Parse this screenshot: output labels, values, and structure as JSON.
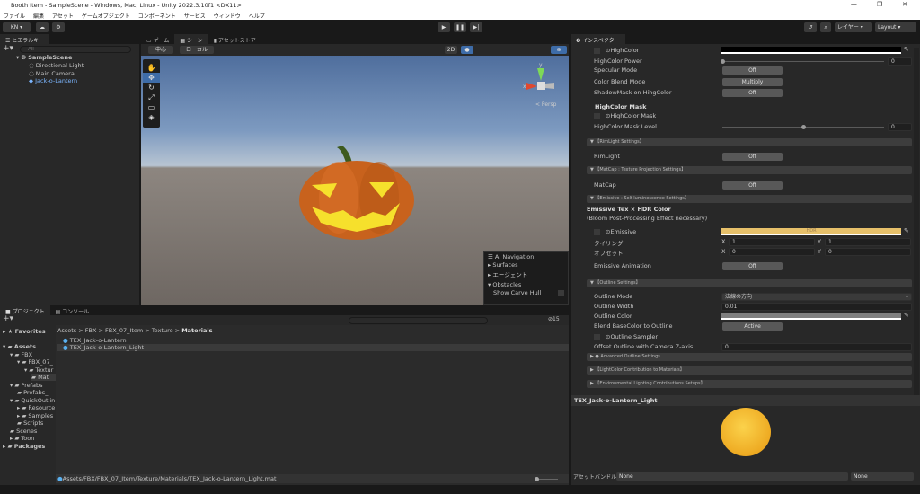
{
  "window": {
    "title": "Booth Item - SampleScene - Windows, Mac, Linux - Unity 2022.3.10f1 <DX11>",
    "controls": [
      "—",
      "❐",
      "✕"
    ]
  },
  "menu": [
    "ファイル",
    "編集",
    "アセット",
    "ゲームオブジェクト",
    "コンポーネント",
    "サービス",
    "ウィンドウ",
    "ヘルプ"
  ],
  "toolbar": {
    "account": "KN ▾",
    "layers": "レイヤー",
    "layout": "Layout"
  },
  "hierarchy": {
    "tab": "ヒエラルキー",
    "search_placeholder": "All",
    "scene": "SampleScene",
    "items": [
      "Directional Light",
      "Main Camera",
      "Jack-o-Lantern"
    ]
  },
  "scene_view": {
    "tabs": [
      "ゲーム",
      "シーン",
      "アセットストア"
    ],
    "pivot": "中心",
    "space": "ローカル",
    "mode_2d": "2D",
    "gizmo_label": "< Persp",
    "axis_x": "x",
    "axis_y": "y",
    "overlay": {
      "title": "AI Navigation",
      "items": [
        "Surfaces",
        "エージェント",
        "Obstacles"
      ],
      "option": "Show Carve Hull"
    }
  },
  "project": {
    "tabs": [
      "プロジェクト",
      "コンソール"
    ],
    "hidden_count": "15",
    "tree": [
      "Favorites",
      "Assets",
      "FBX",
      "FBX_07_",
      "Textur",
      "Mat",
      "Prefabs",
      "Prefabs_",
      "QuickOutlin",
      "Resource",
      "Samples",
      "Scripts",
      "Scenes",
      "Toon",
      "Packages"
    ],
    "breadcrumb": [
      "Assets",
      "FBX",
      "FBX_07_Item",
      "Texture",
      "Materials"
    ],
    "files": [
      "TEX_Jack-o-Lantern",
      "TEX_Jack-o-Lantern_Light"
    ],
    "status_path": "Assets/FBX/FBX_07_Item/Texture/Materials/TEX_Jack-o-Lantern_Light.mat"
  },
  "inspector": {
    "tab": "インスペクター",
    "rows": [
      {
        "t": "color",
        "label": "⊙HighColor",
        "color": "#000000"
      },
      {
        "t": "slider",
        "label": "HighColor Power",
        "value": "0",
        "pos": 0
      },
      {
        "t": "btn",
        "label": "Specular Mode",
        "value": "Off"
      },
      {
        "t": "btn",
        "label": "Color Blend Mode",
        "value": "Multiply"
      },
      {
        "t": "btn",
        "label": "ShadowMask on HihgColor",
        "value": "Off"
      },
      {
        "t": "bold",
        "label": "HighColor Mask"
      },
      {
        "t": "check",
        "label": "⊙HighColor Mask"
      },
      {
        "t": "slider",
        "label": "HighColor Mask Level",
        "value": "0",
        "pos": 0.5
      },
      {
        "t": "hdr",
        "label": "▼ 【RimLight Settings】"
      },
      {
        "t": "btn",
        "label": "RimLight",
        "value": "Off"
      },
      {
        "t": "hdr",
        "label": "▼ 【MatCap : Texture Projection Settings】"
      },
      {
        "t": "btn",
        "label": "MatCap",
        "value": "Off"
      },
      {
        "t": "hdr",
        "label": "▼ 【Emissive : Self-luminescence Settings】"
      },
      {
        "t": "bold",
        "label": "Emissive Tex × HDR Color"
      },
      {
        "t": "text",
        "label": "(Bloom Post-Processing Effect necessary)"
      },
      {
        "t": "color",
        "label": "⊙Emissive",
        "color": "#e6c06a",
        "value": "HDR"
      },
      {
        "t": "xy",
        "label": "タイリング",
        "x": "1",
        "y": "1"
      },
      {
        "t": "xy",
        "label": "オフセット",
        "x": "0",
        "y": "0"
      },
      {
        "t": "btn",
        "label": "Emissive Animation",
        "value": "Off"
      },
      {
        "t": "hdr",
        "label": "▼ 【Outline Settings】"
      },
      {
        "t": "drop",
        "label": "Outline Mode",
        "value": "法線の方向"
      },
      {
        "t": "field",
        "label": "Outline Width",
        "value": "0.01"
      },
      {
        "t": "color",
        "label": "Outline Color",
        "color": "#808080"
      },
      {
        "t": "btn",
        "label": "Blend BaseColor to Outline",
        "value": "Active"
      },
      {
        "t": "check",
        "label": "⊙Outline Sampler"
      },
      {
        "t": "field",
        "label": "Offset Outline with Camera Z-axis",
        "value": "0"
      },
      {
        "t": "hdr",
        "label": "▶ ● Advanced Outline Settings"
      },
      {
        "t": "hdr",
        "label": "▶ 【LightColor Contribution to Materials】"
      },
      {
        "t": "hdr",
        "label": "▶ 【Environmental Lighting Contributions Setups】"
      }
    ],
    "preview_title": "TEX_Jack-o-Lantern_Light",
    "asset_bundle_label": "アセットバンドル",
    "bundle": "None",
    "variant": "None"
  }
}
